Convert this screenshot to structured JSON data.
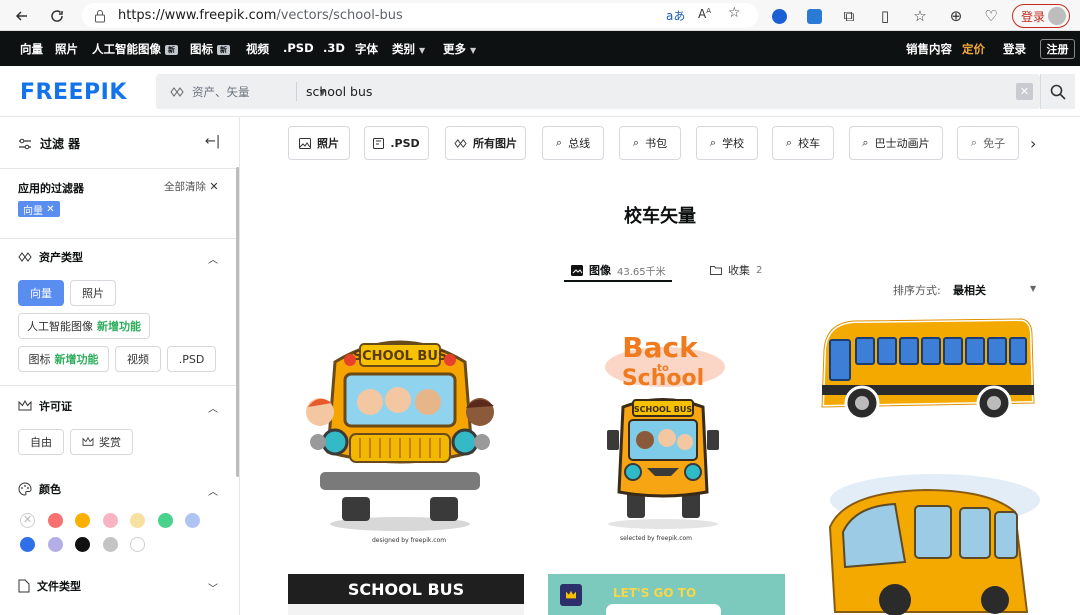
{
  "browser": {
    "url_host": "https://www.freepik.com",
    "url_path": "/vectors/school-bus",
    "read_aloud": "aあ",
    "login_label": "登录"
  },
  "topnav": {
    "items": [
      "向量",
      "照片",
      "人工智能图像",
      "图标",
      "视频",
      ".PSD",
      ".3D",
      "字体",
      "类别",
      "更多"
    ],
    "new_badge": "新",
    "right": [
      "销售内容",
      "定价",
      "登录",
      "注册"
    ]
  },
  "header": {
    "logo": "FREEPIK",
    "search_type": "资产、矢量",
    "search_query": "school bus"
  },
  "sidebar": {
    "filters_title": "过滤 器",
    "applied_title": "应用的过滤器",
    "clear_all": "全部清除",
    "applied_tag": "向量",
    "asset_type_title": "资产类型",
    "asset_types": [
      "向量",
      "照片",
      "人工智能图像",
      "图标",
      "视频",
      ".PSD"
    ],
    "new_feature": "新增功能",
    "license_title": "许可证",
    "licenses": [
      "自由",
      "奖赏"
    ],
    "color_title": "颜色",
    "colors": [
      "#ffffff",
      "#f87171",
      "#fbb000",
      "#f9b4c4",
      "#f7e0a0",
      "#4ad28c",
      "#b0c4f4",
      "#2f6fe8",
      "#b4aee6",
      "#111111",
      "#c4c4c4",
      "#ffffff"
    ],
    "filetype_title": "文件类型"
  },
  "main": {
    "pills": [
      "照片",
      ".PSD",
      "所有图片",
      "总线",
      "书包",
      "学校",
      "校车",
      "巴士动画片",
      "免子"
    ],
    "page_title": "校车矢量",
    "tab_images": "图像",
    "tab_images_count": "43.65千米",
    "tab_collections": "收集",
    "tab_collections_count": "2",
    "sort_label": "排序方式:",
    "sort_value": "最相关",
    "card1_sign": "SCHOOL BUS",
    "card1_credit": "designed by freepik.com",
    "card2_title": "Back",
    "card2_title_to": "to",
    "card2_title_school": "School",
    "card2_sign": "SCHOOL BUS",
    "card2_credit": "selected by freepik.com",
    "card4_banner": "SCHOOL BUS",
    "card5_text": "LET'S GO TO"
  }
}
